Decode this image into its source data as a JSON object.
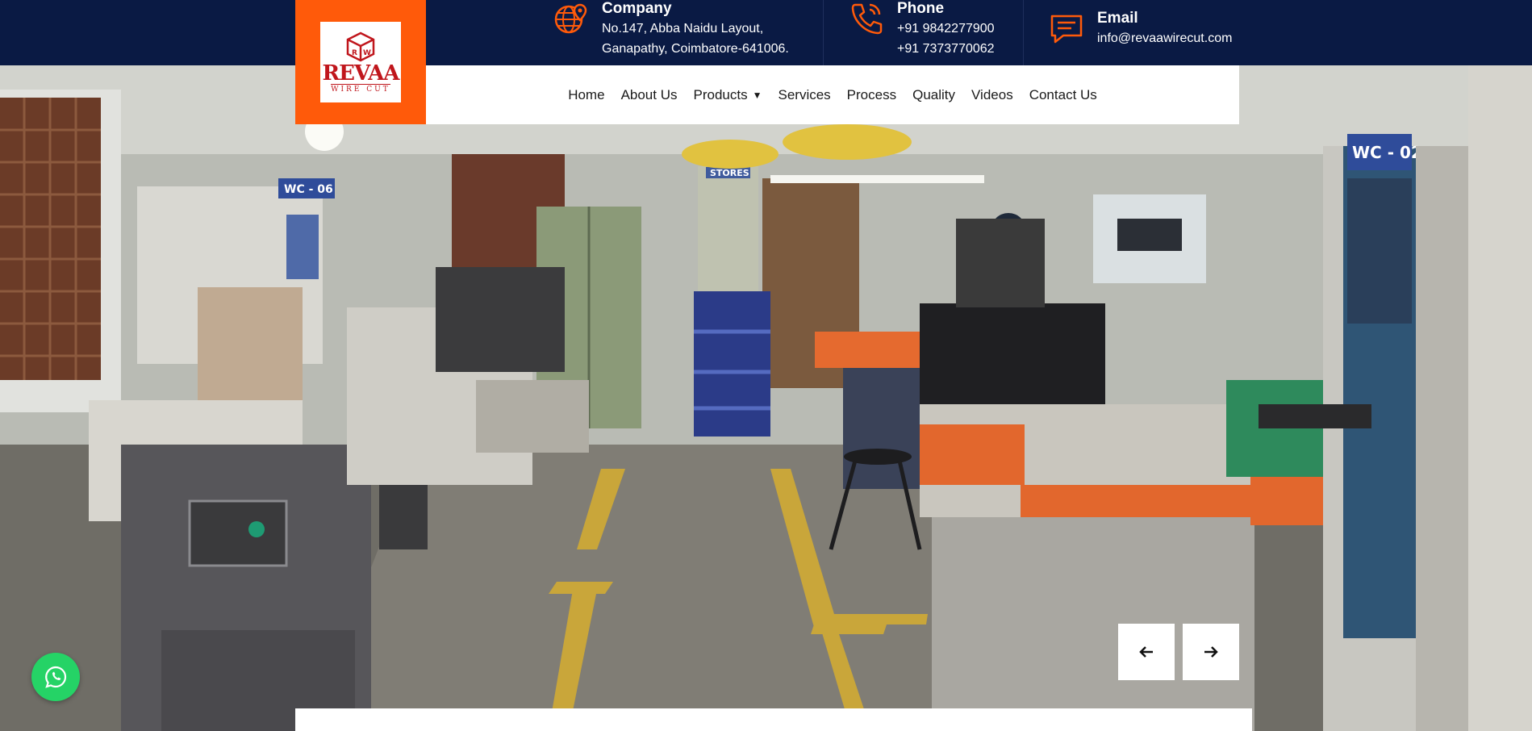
{
  "brand": {
    "name": "REVAA",
    "tagline": "WIRE CUT",
    "colors": {
      "topbar": "#0a1a44",
      "accent": "#ff5a0a",
      "logo_red": "#c0161c"
    }
  },
  "contact": {
    "company": {
      "title": "Company",
      "line1": "No.147, Abba Naidu Layout,",
      "line2": "Ganapathy, Coimbatore-641006.",
      "icon": "globe-location-icon"
    },
    "phone": {
      "title": "Phone",
      "line1": "+91 9842277900",
      "line2": "+91 7373770062",
      "icon": "phone-icon"
    },
    "email": {
      "title": "Email",
      "line1": "info@revaawirecut.com",
      "icon": "chat-message-icon"
    }
  },
  "nav": {
    "items": [
      {
        "label": "Home"
      },
      {
        "label": "About Us"
      },
      {
        "label": "Products",
        "caret": "▼"
      },
      {
        "label": "Services"
      },
      {
        "label": "Process"
      },
      {
        "label": "Quality"
      },
      {
        "label": "Videos"
      },
      {
        "label": "Contact Us"
      }
    ]
  },
  "hero": {
    "signs": {
      "stores": "STORES",
      "machine_left": "WC - 06",
      "machine_right": "WC - 02"
    },
    "prev_icon": "arrow-left-icon",
    "next_icon": "arrow-right-icon"
  },
  "floating": {
    "whatsapp_icon": "whatsapp-icon"
  }
}
